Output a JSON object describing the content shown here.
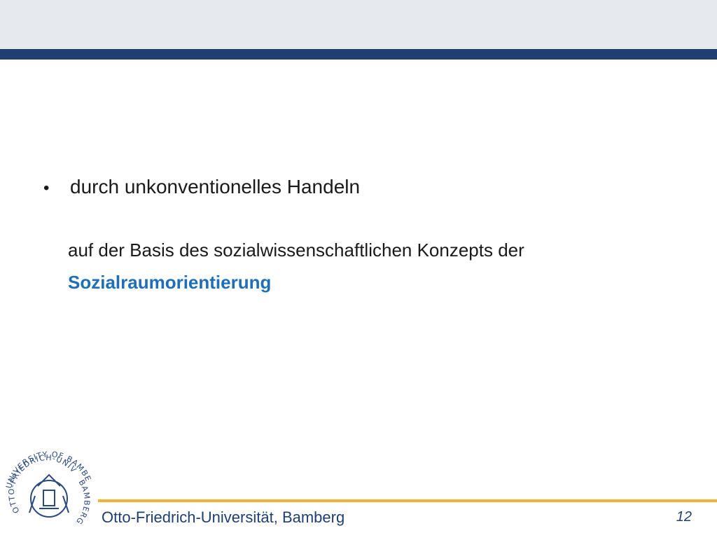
{
  "slide": {
    "bullet_symbol": "•",
    "bullet_text": "durch unkonventionelles Handeln",
    "line2": "auf der Basis des sozialwissenschaftlichen Konzepts der",
    "line3": "Sozialraumorientierung"
  },
  "footer": {
    "institution": "Otto-Friedrich-Universität, Bamberg",
    "page_number": "12"
  },
  "seal": {
    "inner_ring_text": "OTTO-FRIEDRICH-UNIVERSITÄT",
    "outer_ring_text": "UNIVERSITY OF BAMBERG",
    "right_ring_text": "BAMBERG"
  },
  "colors": {
    "header_band": "#e6e9ee",
    "header_bar": "#1f3f72",
    "accent_blue": "#1f6fb8",
    "footer_rule": "#f2b234",
    "seal_blue": "#2a4a80"
  }
}
